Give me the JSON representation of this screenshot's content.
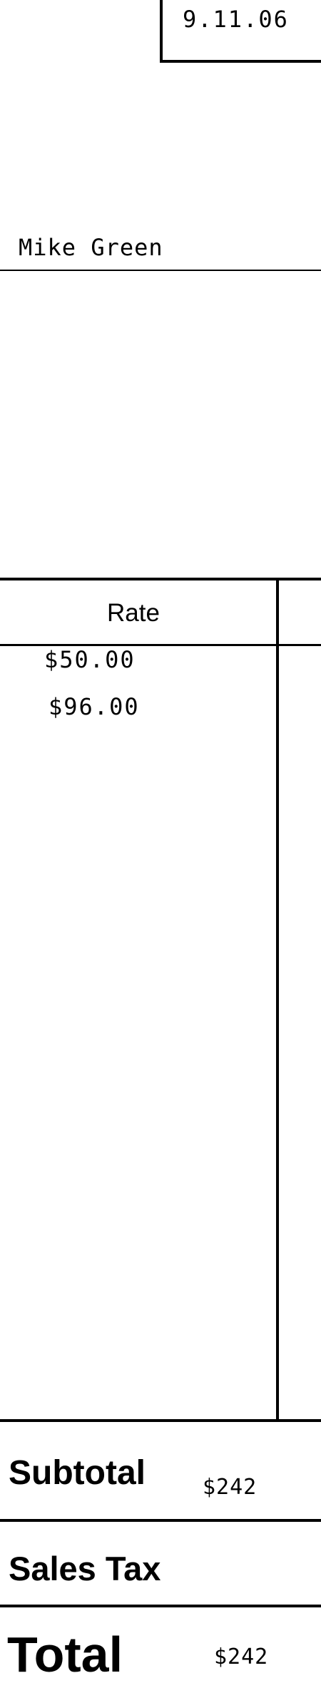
{
  "invoice": {
    "date": "9.11.06",
    "client_name": "Mike Green"
  },
  "table": {
    "rate_header": "Rate",
    "rates": [
      "$50.00",
      "$96.00"
    ]
  },
  "totals": {
    "subtotal_label": "Subtotal",
    "subtotal_value": "$242",
    "sales_tax_label": "Sales Tax",
    "total_label": "Total",
    "total_value": "$242"
  }
}
